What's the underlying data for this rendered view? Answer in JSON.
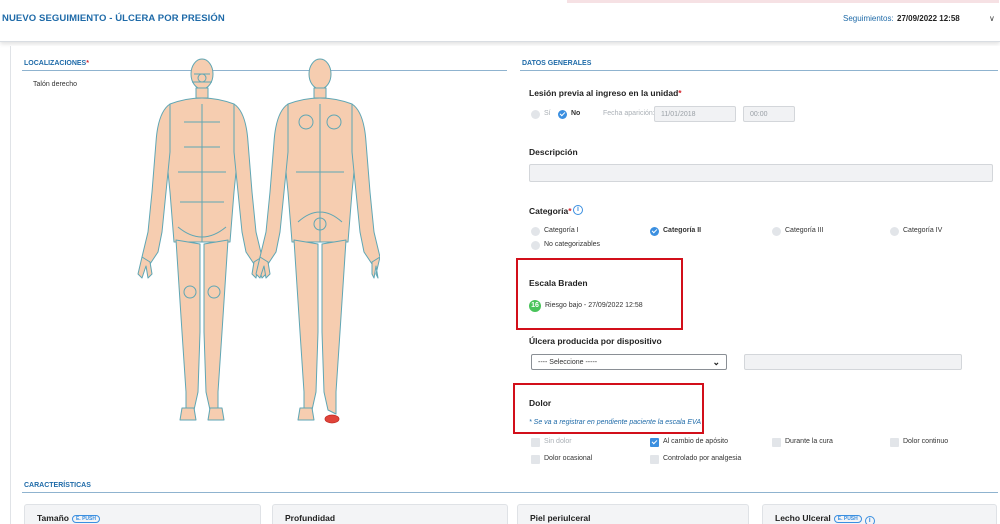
{
  "header": {
    "title": "NUEVO SEGUIMIENTO - ÚLCERA POR PRESIÓN",
    "seguimientos_label": "Seguimientos:",
    "seguimientos_value": "27/09/2022 12:58"
  },
  "localizaciones": {
    "heading": "LOCALIZACIONES",
    "required_mark": "*",
    "selected_location": "Talón derecho"
  },
  "datos_generales": {
    "heading": "DATOS GENERALES",
    "lesion_previa": {
      "label": "Lesión previa al ingreso en la unidad",
      "required_mark": "*",
      "options": [
        "Sí",
        "No"
      ],
      "selected": "No",
      "fecha_label": "Fecha aparición:",
      "fecha_value": "11/01/2018",
      "hora_value": "00:00"
    },
    "descripcion": {
      "label": "Descripción",
      "value": ""
    },
    "categoria": {
      "label": "Categoría",
      "required_mark": "*",
      "info_icon": "i",
      "options": [
        "Categoría I",
        "Categoría II",
        "Categoría III",
        "Categoría IV",
        "No categorizables"
      ],
      "selected": "Categoría II"
    },
    "escala_braden": {
      "label": "Escala Braden",
      "score": "16",
      "text": "Riesgo bajo - 27/09/2022 12:58"
    },
    "ulcera_dispositivo": {
      "label": "Úlcera producida por dispositivo",
      "select_value": "---- Seleccione -----",
      "text_value": ""
    },
    "dolor": {
      "label": "Dolor",
      "note": "* Se va a registrar en pendiente paciente la escala EVA",
      "options": [
        {
          "label": "Sin dolor",
          "checked": false,
          "disabled": true
        },
        {
          "label": "Al cambio de apósito",
          "checked": true,
          "disabled": false
        },
        {
          "label": "Durante la cura",
          "checked": false,
          "disabled": false
        },
        {
          "label": "Dolor continuo",
          "checked": false,
          "disabled": false
        },
        {
          "label": "Dolor ocasional",
          "checked": false,
          "disabled": false
        },
        {
          "label": "Controlado por analgesia",
          "checked": false,
          "disabled": false
        }
      ]
    }
  },
  "caracteristicas": {
    "heading": "CARACTERÍSTICAS",
    "cards": [
      {
        "label": "Tamaño",
        "badge": "E. PUSH"
      },
      {
        "label": "Profundidad",
        "badge": ""
      },
      {
        "label": "Piel periulceral",
        "badge": ""
      },
      {
        "label": "Lecho Ulceral",
        "badge": "E. PUSH",
        "info_icon": "i"
      }
    ]
  },
  "colors": {
    "accent": "#1e6aa8",
    "checked": "#3b8fe0",
    "required": "#d6262f",
    "highlight_box": "#d20f1a",
    "score_badge": "#49c35a",
    "body_fill": "#f6cdb0",
    "body_stroke": "#5fa6b4",
    "lesion_marker": "#e0443a"
  },
  "icons": {
    "dropdown": "chevron-down-icon",
    "info": "info-icon",
    "check": "check-icon"
  }
}
